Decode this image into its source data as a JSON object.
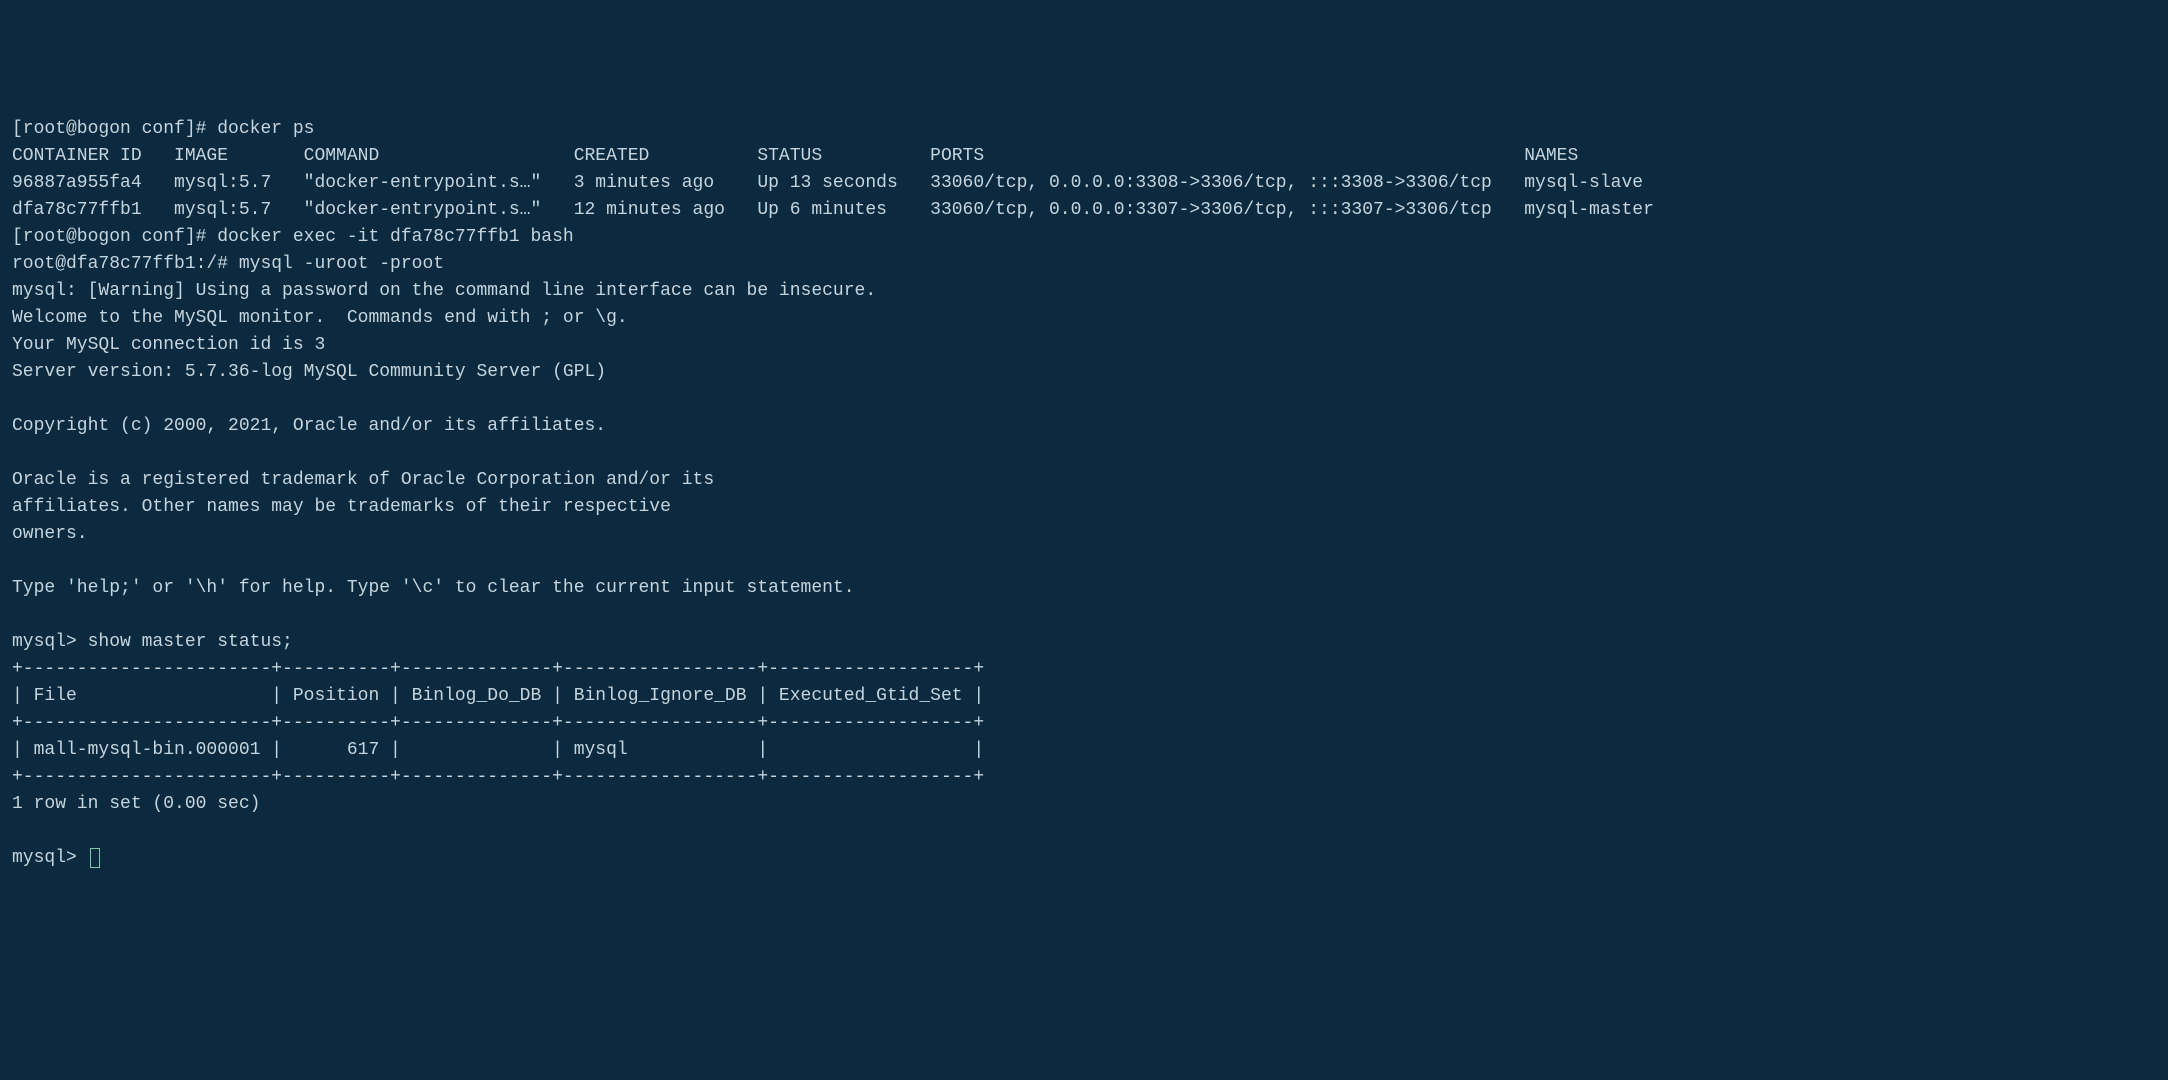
{
  "lines": {
    "l0": "[root@bogon conf]# docker ps",
    "l1": "CONTAINER ID   IMAGE       COMMAND                  CREATED          STATUS          PORTS                                                  NAMES",
    "l2": "96887a955fa4   mysql:5.7   \"docker-entrypoint.s…\"   3 minutes ago    Up 13 seconds   33060/tcp, 0.0.0.0:3308->3306/tcp, :::3308->3306/tcp   mysql-slave",
    "l3": "dfa78c77ffb1   mysql:5.7   \"docker-entrypoint.s…\"   12 minutes ago   Up 6 minutes    33060/tcp, 0.0.0.0:3307->3306/tcp, :::3307->3306/tcp   mysql-master",
    "l4": "[root@bogon conf]# docker exec -it dfa78c77ffb1 bash",
    "l5": "root@dfa78c77ffb1:/# mysql -uroot -proot",
    "l6": "mysql: [Warning] Using a password on the command line interface can be insecure.",
    "l7": "Welcome to the MySQL monitor.  Commands end with ; or \\g.",
    "l8": "Your MySQL connection id is 3",
    "l9": "Server version: 5.7.36-log MySQL Community Server (GPL)",
    "l10": "",
    "l11": "Copyright (c) 2000, 2021, Oracle and/or its affiliates.",
    "l12": "",
    "l13": "Oracle is a registered trademark of Oracle Corporation and/or its",
    "l14": "affiliates. Other names may be trademarks of their respective",
    "l15": "owners.",
    "l16": "",
    "l17": "Type 'help;' or '\\h' for help. Type '\\c' to clear the current input statement.",
    "l18": "",
    "l19": "mysql> show master status;",
    "l20": "+-----------------------+----------+--------------+------------------+-------------------+",
    "l21": "| File                  | Position | Binlog_Do_DB | Binlog_Ignore_DB | Executed_Gtid_Set |",
    "l22": "+-----------------------+----------+--------------+------------------+-------------------+",
    "l23": "| mall-mysql-bin.000001 |      617 |              | mysql            |                   |",
    "l24": "+-----------------------+----------+--------------+------------------+-------------------+",
    "l25": "1 row in set (0.00 sec)",
    "l26": "",
    "l27": "mysql> "
  },
  "docker_ps": {
    "headers": [
      "CONTAINER ID",
      "IMAGE",
      "COMMAND",
      "CREATED",
      "STATUS",
      "PORTS",
      "NAMES"
    ],
    "rows": [
      {
        "container_id": "96887a955fa4",
        "image": "mysql:5.7",
        "command": "\"docker-entrypoint.s…\"",
        "created": "3 minutes ago",
        "status": "Up 13 seconds",
        "ports": "33060/tcp, 0.0.0.0:3308->3306/tcp, :::3308->3306/tcp",
        "names": "mysql-slave"
      },
      {
        "container_id": "dfa78c77ffb1",
        "image": "mysql:5.7",
        "command": "\"docker-entrypoint.s…\"",
        "created": "12 minutes ago",
        "status": "Up 6 minutes",
        "ports": "33060/tcp, 0.0.0.0:3307->3306/tcp, :::3307->3306/tcp",
        "names": "mysql-master"
      }
    ]
  },
  "mysql_master_status": {
    "headers": [
      "File",
      "Position",
      "Binlog_Do_DB",
      "Binlog_Ignore_DB",
      "Executed_Gtid_Set"
    ],
    "row": {
      "File": "mall-mysql-bin.000001",
      "Position": "617",
      "Binlog_Do_DB": "",
      "Binlog_Ignore_DB": "mysql",
      "Executed_Gtid_Set": ""
    },
    "result_summary": "1 row in set (0.00 sec)"
  },
  "commands": {
    "host_prompt": "[root@bogon conf]#",
    "docker_ps_cmd": "docker ps",
    "docker_exec_cmd": "docker exec -it dfa78c77ffb1 bash",
    "container_prompt": "root@dfa78c77ffb1:/#",
    "mysql_login_cmd": "mysql -uroot -proot",
    "mysql_prompt": "mysql>",
    "show_master_status_cmd": "show master status;"
  }
}
